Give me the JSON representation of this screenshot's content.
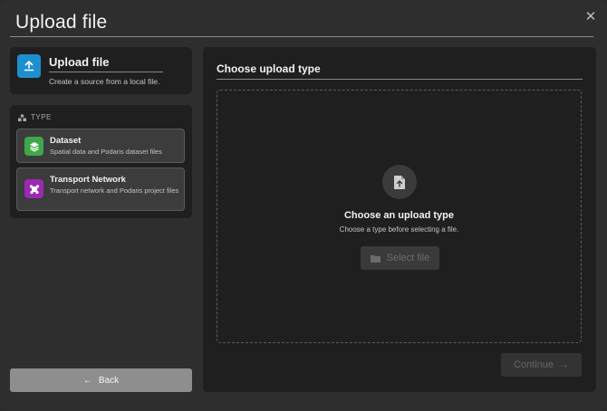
{
  "dialog": {
    "title": "Upload file",
    "close_icon": "close-icon"
  },
  "source": {
    "title": "Upload file",
    "subtitle": "Create a source from a local file.",
    "icon": "upload-icon",
    "icon_color": "#1d8fcf"
  },
  "type_section": {
    "heading": "TYPE",
    "icon": "shapes-icon",
    "options": [
      {
        "title": "Dataset",
        "description": "Spatial data and Podaris dataset files",
        "icon": "layers-icon",
        "color": "#3ea84a"
      },
      {
        "title": "Transport Network",
        "description": "Transport network and Podaris project files",
        "icon": "network-icon",
        "color": "#9b2ab0"
      }
    ]
  },
  "back_button": {
    "label": "Back",
    "icon": "arrow-left-icon"
  },
  "upload_panel": {
    "title": "Choose upload type",
    "empty_title": "Choose an upload type",
    "empty_subtitle": "Choose a type before selecting a file.",
    "empty_icon": "file-upload-icon",
    "select_button": {
      "label": "Select file",
      "icon": "folder-icon"
    },
    "continue_button": {
      "label": "Continue",
      "icon": "arrow-right-icon"
    }
  }
}
